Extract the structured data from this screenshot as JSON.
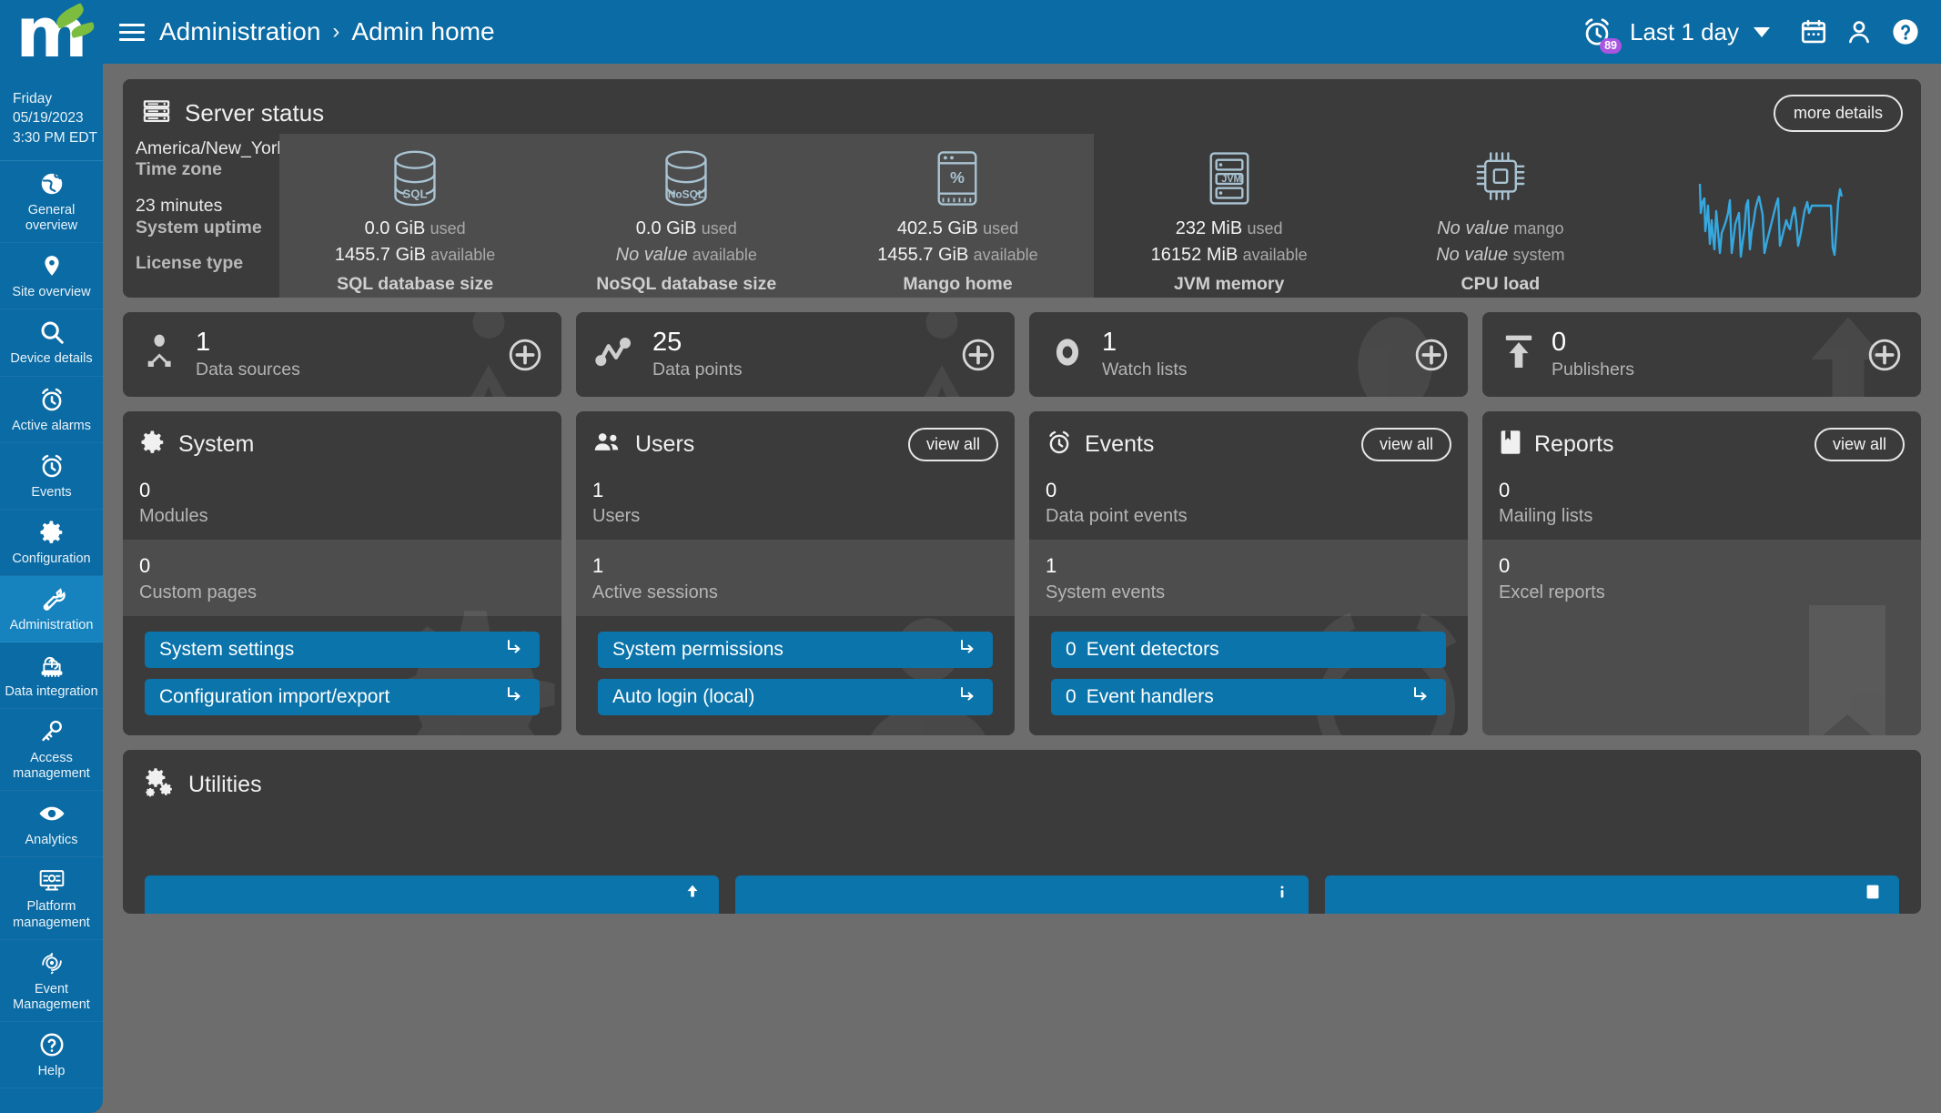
{
  "brand": {
    "logo_letter": "m",
    "logo_name": "mango-logo"
  },
  "clock": {
    "day": "Friday",
    "date": "05/19/2023",
    "time": "3:30 PM EDT"
  },
  "sidebar": {
    "items": [
      {
        "label": "General overview",
        "icon": "globe-icon",
        "active": false
      },
      {
        "label": "Site overview",
        "icon": "map-pin-icon",
        "active": false
      },
      {
        "label": "Device details",
        "icon": "search-icon",
        "active": false
      },
      {
        "label": "Active alarms",
        "icon": "alarm-clock-icon",
        "active": false
      },
      {
        "label": "Events",
        "icon": "alarm-clock-icon",
        "active": false
      },
      {
        "label": "Configuration",
        "icon": "gear-icon",
        "active": false
      },
      {
        "label": "Administration",
        "icon": "wrench-icon",
        "active": true
      },
      {
        "label": "Data integration",
        "icon": "cloud-upload-icon",
        "active": false
      },
      {
        "label": "Access management",
        "icon": "key-icon",
        "active": false
      },
      {
        "label": "Analytics",
        "icon": "eye-icon",
        "active": false
      },
      {
        "label": "Platform management",
        "icon": "monitor-gear-icon",
        "active": false
      },
      {
        "label": "Event Management",
        "icon": "gear-cycle-icon",
        "active": false
      },
      {
        "label": "Help",
        "icon": "question-circle-icon",
        "active": false
      }
    ]
  },
  "topbar": {
    "menu_icon": "hamburger-icon",
    "breadcrumb": [
      "Administration",
      "Admin home"
    ],
    "separator": "›",
    "alarm_icon": "alarm-clock-icon",
    "alarm_badge": "89",
    "time_range": "Last 1 day",
    "calendar_icon": "calendar-icon",
    "user_icon": "user-icon",
    "help_icon": "help-circle-icon"
  },
  "server_status": {
    "icon": "server-icon",
    "title": "Server status",
    "more_details": "more details",
    "info": [
      {
        "value": "America/New_York",
        "label": "Time zone"
      },
      {
        "value": "23 minutes",
        "label": "System uptime"
      },
      {
        "value": "",
        "label": "License type"
      }
    ],
    "metrics": [
      {
        "icon": "database-sql-icon",
        "icon_text": "SQL",
        "shaded": true,
        "line1_value": "0.0 GiB",
        "line1_unit": "used",
        "line2_value": "1455.7 GiB",
        "line2_unit": "available",
        "line2_novalue": false,
        "label": "SQL database size"
      },
      {
        "icon": "database-nosql-icon",
        "icon_text": "NoSQL",
        "shaded": true,
        "line1_value": "0.0 GiB",
        "line1_unit": "used",
        "line2_value": "No value",
        "line2_unit": "available",
        "line2_novalue": true,
        "label": "NoSQL database size"
      },
      {
        "icon": "database-percent-icon",
        "icon_text": "%",
        "shaded": true,
        "line1_value": "402.5 GiB",
        "line1_unit": "used",
        "line2_value": "1455.7 GiB",
        "line2_unit": "available",
        "line2_novalue": false,
        "label": "Mango home"
      },
      {
        "icon": "jvm-icon",
        "icon_text": "JVM",
        "shaded": false,
        "line1_value": "232 MiB",
        "line1_unit": "used",
        "line2_value": "16152 MiB",
        "line2_unit": "available",
        "line2_novalue": false,
        "label": "JVM memory"
      },
      {
        "icon": "cpu-icon",
        "icon_text": "",
        "shaded": false,
        "line1_value": "No value",
        "line1_unit": "mango",
        "line1_novalue": true,
        "line2_value": "No value",
        "line2_unit": "system",
        "line2_novalue": true,
        "label": "CPU load"
      }
    ],
    "sparkline_color": "#35a8e0"
  },
  "counters": [
    {
      "icon": "data-source-icon",
      "count": "1",
      "label": "Data sources",
      "add_icon": "plus-circle-icon"
    },
    {
      "icon": "data-point-icon",
      "count": "25",
      "label": "Data points",
      "add_icon": "plus-circle-icon"
    },
    {
      "icon": "watch-list-icon",
      "count": "1",
      "label": "Watch lists",
      "add_icon": "plus-circle-icon"
    },
    {
      "icon": "publisher-icon",
      "count": "0",
      "label": "Publishers",
      "add_icon": "plus-circle-icon"
    }
  ],
  "panels": [
    {
      "icon": "gear-icon",
      "title": "System",
      "view_all": null,
      "stats": [
        {
          "value": "0",
          "label": "Modules"
        },
        {
          "value": "0",
          "label": "Custom pages"
        }
      ],
      "actions": [
        {
          "count": "",
          "label": "System settings",
          "arrow": "enter-arrow-icon"
        },
        {
          "count": "",
          "label": "Configuration import/export",
          "arrow": "enter-arrow-icon"
        }
      ]
    },
    {
      "icon": "users-icon",
      "title": "Users",
      "view_all": "view all",
      "stats": [
        {
          "value": "1",
          "label": "Users"
        },
        {
          "value": "1",
          "label": "Active sessions"
        }
      ],
      "actions": [
        {
          "count": "",
          "label": "System permissions",
          "arrow": "enter-arrow-icon"
        },
        {
          "count": "",
          "label": "Auto login (local)",
          "arrow": "enter-arrow-icon"
        }
      ]
    },
    {
      "icon": "alarm-clock-icon",
      "title": "Events",
      "view_all": "view all",
      "stats": [
        {
          "value": "0",
          "label": "Data point events"
        },
        {
          "value": "1",
          "label": "System events"
        }
      ],
      "actions": [
        {
          "count": "0",
          "label": "Event detectors",
          "arrow": ""
        },
        {
          "count": "0",
          "label": "Event handlers",
          "arrow": "enter-arrow-icon"
        }
      ]
    },
    {
      "icon": "bookmark-icon",
      "title": "Reports",
      "view_all": "view all",
      "stats": [
        {
          "value": "0",
          "label": "Mailing lists"
        },
        {
          "value": "0",
          "label": "Excel reports"
        }
      ],
      "actions": []
    }
  ],
  "utilities": {
    "icon": "gears-icon",
    "title": "Utilities",
    "buttons": [
      {
        "label": "",
        "icon": "upload-icon"
      },
      {
        "label": "",
        "icon": "info-icon"
      },
      {
        "label": "",
        "icon": "doc-icon"
      }
    ]
  }
}
